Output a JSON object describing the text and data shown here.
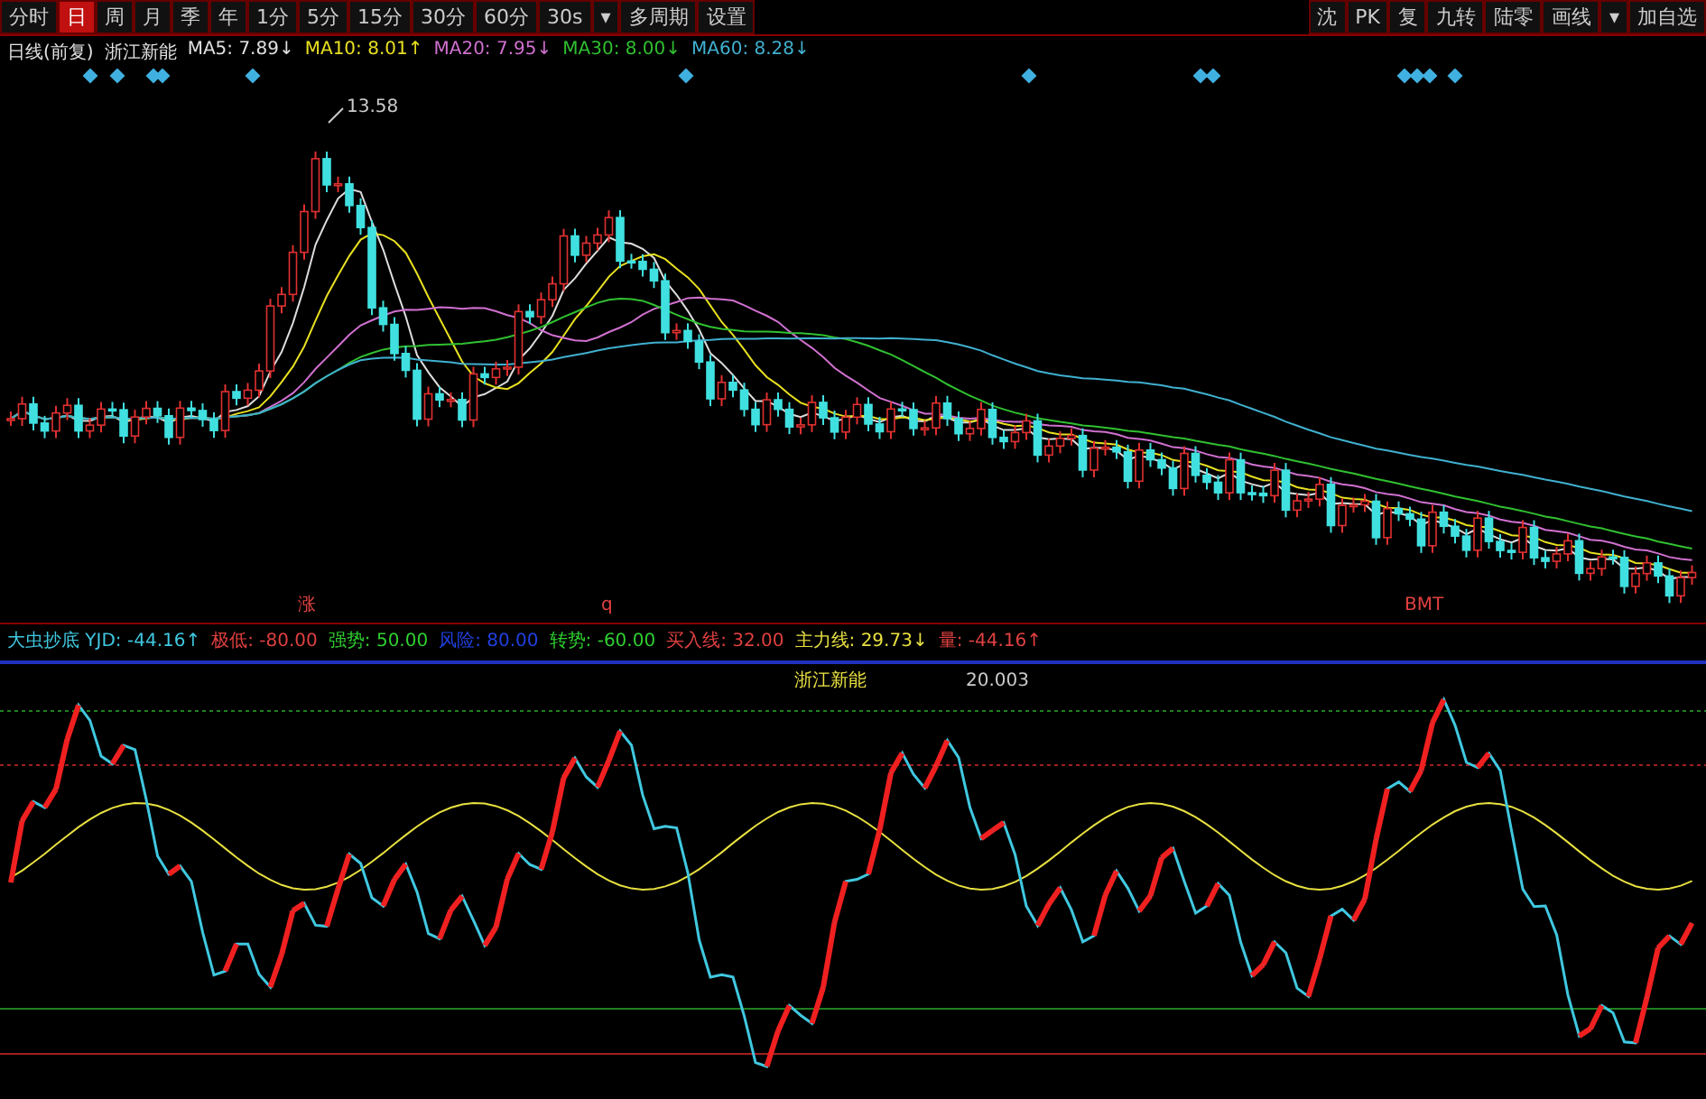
{
  "toolbar": {
    "left": [
      {
        "label": "分时",
        "selected": false
      },
      {
        "label": "日",
        "selected": true
      },
      {
        "label": "周",
        "selected": false
      },
      {
        "label": "月",
        "selected": false
      },
      {
        "label": "季",
        "selected": false
      },
      {
        "label": "年",
        "selected": false
      },
      {
        "label": "1分",
        "selected": false
      },
      {
        "label": "5分",
        "selected": false
      },
      {
        "label": "15分",
        "selected": false
      },
      {
        "label": "30分",
        "selected": false
      },
      {
        "label": "60分",
        "selected": false
      },
      {
        "label": "30s",
        "selected": false
      },
      {
        "label": "▾",
        "selected": false
      },
      {
        "label": "多周期",
        "selected": false
      },
      {
        "label": "设置",
        "selected": false
      }
    ],
    "right": [
      "沈",
      "PK",
      "复",
      "九转",
      "陆零",
      "画线",
      "▾",
      "加自选"
    ]
  },
  "price_legend": [
    {
      "text": "日线(前复)",
      "color": "#e0e0e0"
    },
    {
      "text": "浙江新能",
      "color": "#e0e0e0"
    },
    {
      "text": "MA5: 7.89↓",
      "color": "#e0e0e0"
    },
    {
      "text": "MA10: 8.01↑",
      "color": "#e8e020"
    },
    {
      "text": "MA20: 7.95↓",
      "color": "#d070d0"
    },
    {
      "text": "MA30: 8.00↓",
      "color": "#30c030"
    },
    {
      "text": "MA60: 8.28↓",
      "color": "#40b0d0"
    }
  ],
  "price_chart": {
    "high_label": "13.58",
    "markers": [
      "涨",
      "q",
      "BMT"
    ]
  },
  "indicator_legend": [
    {
      "text": "大虫抄底 YJD: -44.16↑",
      "color": "#40c8e0"
    },
    {
      "text": "极低: -80.00",
      "color": "#e04040"
    },
    {
      "text": "强势: 50.00",
      "color": "#30d030"
    },
    {
      "text": "风险: 80.00",
      "color": "#2040e0"
    },
    {
      "text": "转势: -60.00",
      "color": "#30d030"
    },
    {
      "text": "买入线: 32.00",
      "color": "#e04040"
    },
    {
      "text": "主力线: 29.73↓",
      "color": "#e8e040"
    },
    {
      "text": "量: -44.16↑",
      "color": "#e04040"
    }
  ],
  "indicator_chart": {
    "stock_name": "浙江新能",
    "value_label": "20.003"
  }
}
